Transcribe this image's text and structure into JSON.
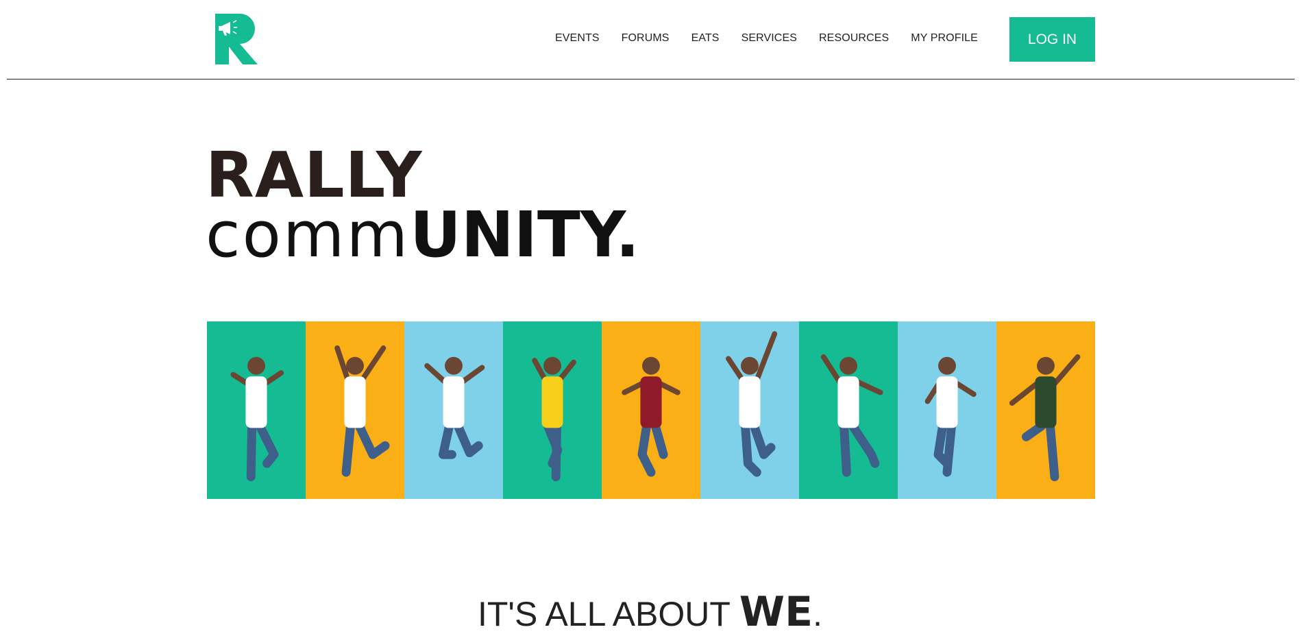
{
  "brand": {
    "logo_letter": "R",
    "accent": "#14bb93"
  },
  "nav": {
    "items": [
      {
        "label": "EVENTS"
      },
      {
        "label": "FORUMS"
      },
      {
        "label": "EATS"
      },
      {
        "label": "SERVICES"
      },
      {
        "label": "RESOURCES"
      },
      {
        "label": "MY PROFILE"
      }
    ],
    "login_label": "LOG IN"
  },
  "hero": {
    "line1": "RALLY",
    "line2_light": "comm",
    "line2_bold": "UNITY."
  },
  "banner": {
    "panel_colors": [
      "#14bb93",
      "#fbaf16",
      "#7fd1ea",
      "#14bb93",
      "#fbaf16",
      "#7fd1ea",
      "#14bb93",
      "#7fd1ea",
      "#fbaf16"
    ],
    "shirt_colors": [
      "#ffffff",
      "#ffffff",
      "#ffffff",
      "#f5cf1a",
      "#8f1b2a",
      "#ffffff",
      "#ffffff",
      "#ffffff",
      "#2e4a2e"
    ]
  },
  "tagline": {
    "prefix": "IT'S ALL ABOUT ",
    "emphasis": "WE",
    "suffix": "."
  }
}
